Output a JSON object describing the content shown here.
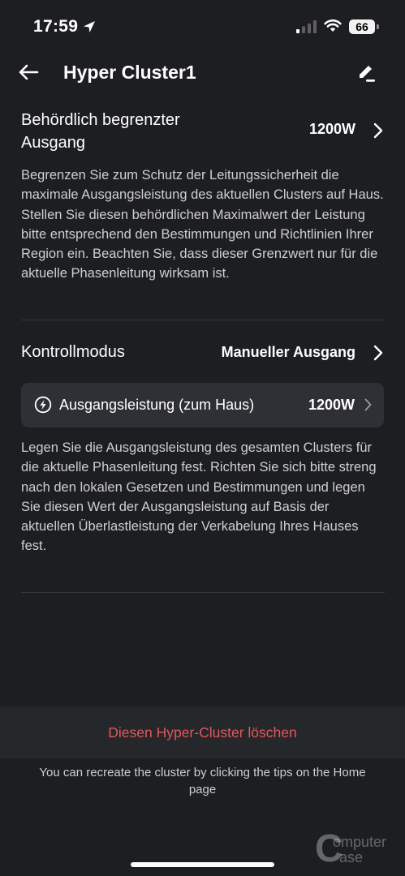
{
  "status_bar": {
    "time": "17:59",
    "battery": "66"
  },
  "nav": {
    "title": "Hyper Cluster1",
    "back_icon": "arrow-left-icon",
    "edit_icon": "pencil-icon"
  },
  "output_limit": {
    "label": "Behördlich begrenzter Ausgang",
    "value": "1200W",
    "description": "Begrenzen Sie zum Schutz der Leitungssicherheit die maximale Ausgangsleistung des aktuellen Clusters auf Haus. Stellen Sie diesen behördlichen Maximalwert der Leistung bitte entsprechend den Bestimmungen und Richtlinien Ihrer Region ein. Beachten Sie, dass dieser Grenzwert nur für die aktuelle Phasenleitung wirksam ist."
  },
  "control_mode": {
    "label": "Kontrollmodus",
    "value": "Manueller Ausgang"
  },
  "output_power": {
    "icon": "bolt-icon",
    "label": "Ausgangsleistung (zum Haus)",
    "value": "1200W",
    "description": "Legen Sie die Ausgangsleistung des gesamten Clusters für die aktuelle Phasenleitung fest. Richten Sie sich bitte streng nach den lokalen Gesetzen und Bestimmungen und legen Sie diesen Wert der Ausgangsleistung auf Basis der aktuellen Überlastleistung der Verkabelung Ihres Hauses fest."
  },
  "delete": {
    "label": "Diesen Hyper-Cluster löschen",
    "color": "#e0585c"
  },
  "tips": "You can recreate the cluster by clicking the tips on the Home page",
  "watermark": {
    "line1": "omputer",
    "line2": "ase"
  },
  "colors": {
    "background": "#1d1e22",
    "card": "#2f3035",
    "delete_bar": "#26272b"
  }
}
